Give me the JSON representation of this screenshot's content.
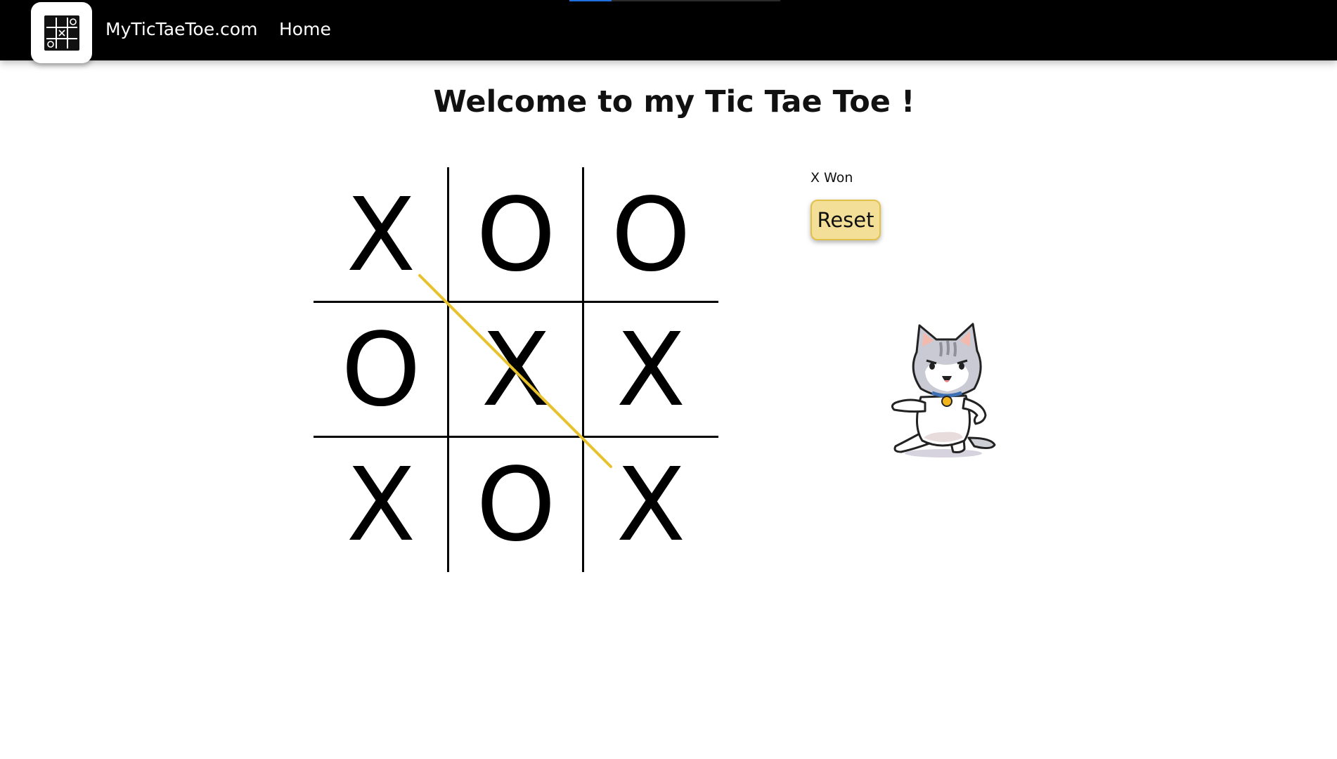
{
  "header": {
    "site_name": "MyTicTaeToe.com",
    "nav_home": "Home",
    "logo_icon": "tic-tac-toe-icon",
    "page_load_progress": 0.2
  },
  "main": {
    "title": "Welcome to my Tic Tae Toe !"
  },
  "game": {
    "board": [
      "X",
      "O",
      "O",
      "O",
      "X",
      "X",
      "X",
      "O",
      "X"
    ],
    "winning_line": {
      "cells": [
        0,
        4,
        8
      ],
      "color": "#e7c22f"
    },
    "status": "X Won",
    "reset_label": "Reset"
  },
  "mascot": {
    "icon": "cat-mascot-icon"
  },
  "colors": {
    "navbar_bg": "#000000",
    "reset_button_bg": "#f3df97",
    "reset_button_border": "#e2c14b",
    "progress_accent": "#1f6fe0"
  }
}
